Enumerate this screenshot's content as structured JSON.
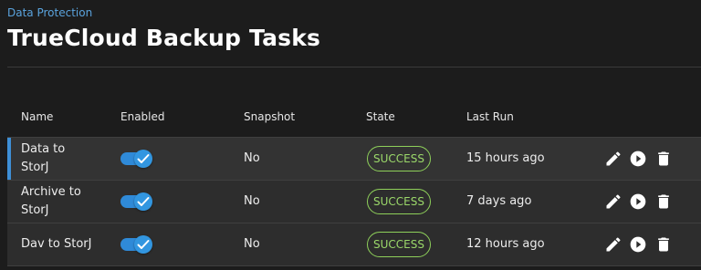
{
  "breadcrumb": "Data Protection",
  "title": "TrueCloud Backup Tasks",
  "columns": {
    "name": "Name",
    "enabled": "Enabled",
    "snapshot": "Snapshot",
    "state": "State",
    "last_run": "Last Run"
  },
  "rows": [
    {
      "name": "Data to StorJ",
      "enabled": true,
      "snapshot": "No",
      "state": "SUCCESS",
      "last_run": "15 hours ago"
    },
    {
      "name": "Archive to StorJ",
      "enabled": true,
      "snapshot": "No",
      "state": "SUCCESS",
      "last_run": "7 days ago"
    },
    {
      "name": "Dav to StorJ",
      "enabled": true,
      "snapshot": "No",
      "state": "SUCCESS",
      "last_run": "12 hours ago"
    }
  ],
  "colors": {
    "accent": "#3e8fd6",
    "breadcrumb": "#5aa3dd",
    "success": "#9bd86a",
    "toggle_on": "#2f8ad8"
  },
  "icons": {
    "edit": "pencil-icon",
    "run": "play-circle-icon",
    "delete": "trash-icon"
  }
}
